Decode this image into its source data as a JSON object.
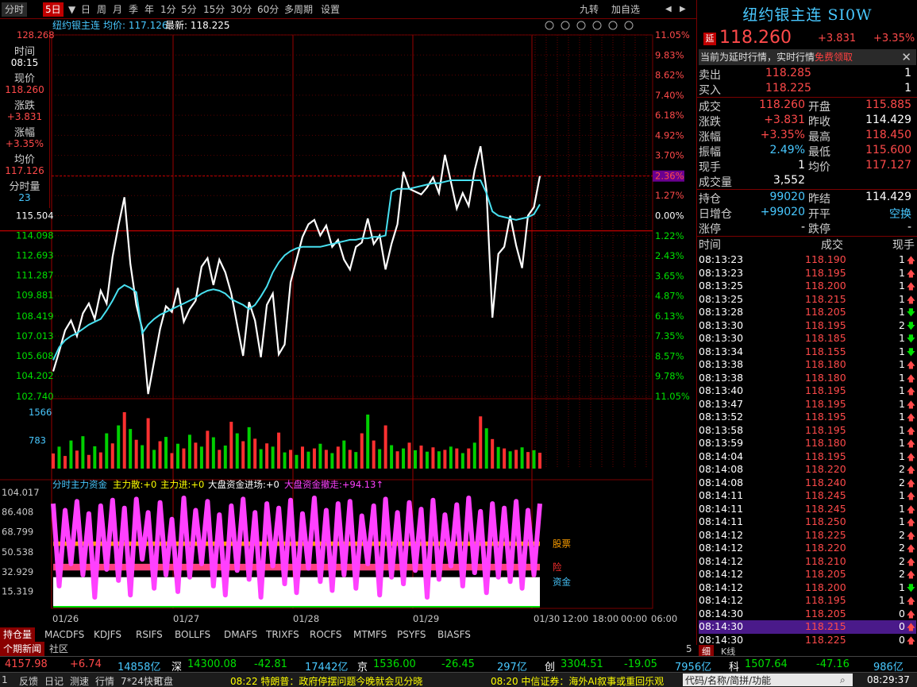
{
  "toolbar": {
    "items": [
      "分时",
      "5日",
      "▼",
      "日",
      "周",
      "月",
      "季",
      "年",
      "1分",
      "5分",
      "15分",
      "30分",
      "60分",
      "多周期",
      "设置"
    ],
    "selected": "5日",
    "right": [
      "九转",
      "加自选"
    ]
  },
  "chart_header": {
    "name": "纽约银主连",
    "avg_label": "均价:",
    "avg_value": "117.126",
    "latest_label": "最新:",
    "latest_value": "118.225"
  },
  "info_panel": {
    "time_label": "时间",
    "time_value": "08:15",
    "price_label": "现价",
    "price_value": "118.260",
    "change_label": "涨跌",
    "change_value": "+3.831",
    "pct_label": "涨幅",
    "pct_value": "+3.35%",
    "avg_label": "均价",
    "avg_value": "117.126",
    "vol_label": "分时量",
    "vol_value": "23"
  },
  "chart_data": [
    {
      "type": "line",
      "y_ticks_left": [
        "128.268",
        "115.504",
        "114.098",
        "112.693",
        "111.287",
        "109.881",
        "108.419",
        "107.013",
        "105.608",
        "104.202",
        "102.740"
      ],
      "y_ticks_right": [
        "11.05%",
        "9.83%",
        "8.62%",
        "7.40%",
        "6.18%",
        "4.92%",
        "3.70%",
        "2.36%",
        "1.27%",
        "0.00%",
        "1.22%",
        "2.43%",
        "3.65%",
        "4.87%",
        "6.13%",
        "7.35%",
        "8.57%",
        "9.78%",
        "11.05%"
      ],
      "x_ticks": [
        "01/26",
        "01/27",
        "01/28",
        "01/29",
        "01/30",
        "12:00",
        "18:00",
        "00:00",
        "06:00"
      ],
      "ylim": [
        102.74,
        128.268
      ],
      "reference_price": 114.429,
      "series": [
        {
          "values": [
            104.5,
            105.9,
            107.4,
            108.1,
            107.0,
            108.6,
            109.3,
            108.2,
            110.2,
            109.3,
            112.6,
            114.8,
            116.8,
            112.1,
            109.2,
            107.5,
            102.9,
            105.2,
            107.5,
            109.1,
            108.7,
            110.4,
            108.0,
            108.9,
            109.5,
            111.9,
            112.5,
            110.6,
            112.4,
            111.5,
            110.0,
            107.8,
            105.6,
            109.4,
            108.1,
            105.5,
            109.2,
            110.0,
            105.7,
            106.4,
            110.8,
            112.4,
            114.0,
            114.9,
            115.2,
            114.1,
            114.8,
            113.3,
            113.8,
            112.4,
            111.7,
            113.3,
            113.6,
            115.3,
            113.5,
            114.1,
            111.7,
            113.5,
            114.9,
            118.6,
            117.4,
            117.2,
            117.0,
            117.5,
            118.2,
            117.1,
            119.8,
            117.9,
            116.0,
            117.1,
            116.2,
            118.7,
            120.4,
            117.3,
            108.3,
            112.8,
            113.3,
            115.5,
            113.4,
            111.8,
            115.5,
            116.1,
            118.3
          ],
          "color": "#ffffff"
        },
        {
          "values": [
            105.3,
            106.2,
            106.7,
            107.0,
            107.2,
            107.5,
            107.8,
            108.0,
            108.2,
            108.8,
            109.5,
            110.3,
            110.6,
            110.4,
            110.1,
            107.2,
            107.8,
            108.2,
            108.5,
            108.7,
            108.9,
            109.1,
            109.3,
            109.5,
            109.7,
            110.0,
            110.2,
            110.3,
            110.2,
            110.0,
            109.6,
            109.4,
            109.2,
            108.9,
            109.2,
            109.8,
            110.5,
            111.5,
            112.2,
            112.7,
            113.0,
            113.2,
            113.3,
            113.3,
            113.3,
            113.3,
            113.4,
            113.5,
            113.6,
            113.7,
            113.8,
            113.8,
            113.9,
            113.9,
            114.0,
            114.0,
            114.1,
            117.2,
            117.4,
            117.4,
            117.4,
            117.5,
            117.6,
            117.7,
            117.8,
            117.8,
            117.9,
            118.0,
            118.0,
            118.0,
            118.0,
            118.0,
            118.0,
            117.1,
            115.8,
            115.5,
            115.4,
            115.3,
            115.2,
            115.3,
            115.4,
            115.6,
            116.3
          ],
          "color": "#48e0f0"
        }
      ]
    },
    {
      "type": "bar",
      "y_ticks_left": [
        "1566",
        "783"
      ],
      "series": [
        {
          "values": [
            420,
            610,
            350,
            780,
            500,
            900,
            380,
            620,
            450,
            980,
            700,
            1200,
            1566,
            1100,
            800,
            650,
            1400,
            520,
            760,
            880,
            430,
            690,
            560,
            940,
            720,
            610,
            1050,
            870,
            520,
            640,
            1300,
            980,
            760,
            1150,
            830,
            540,
            700,
            610,
            1000,
            450,
            520,
            380,
            610,
            470,
            560,
            690,
            520,
            430,
            610,
            780,
            520,
            460,
            980,
            1500,
            780,
            540,
            1200,
            650,
            480,
            560,
            720,
            510,
            640,
            470,
            590,
            480,
            520,
            610,
            560,
            430,
            560,
            720,
            1450,
            1120,
            820,
            600,
            560,
            480,
            520,
            590,
            460,
            510,
            440
          ],
          "colors": [
            "#ff3030",
            "#00d000"
          ]
        }
      ]
    },
    {
      "type": "bar",
      "title": "分时主力资金",
      "legend": [
        {
          "label": "主力散:",
          "value": "+0",
          "color": "#ffff00"
        },
        {
          "label": "主力进:",
          "value": "+0",
          "color": "#ffff00"
        },
        {
          "label": "大盘资金进场:",
          "value": "+0",
          "color": "#ffffff"
        },
        {
          "label": "大盘资金撤走:",
          "value": "+94.13↑",
          "color": "#ff40ff"
        }
      ],
      "y_ticks_left": [
        "104.017",
        "86.408",
        "68.799",
        "50.538",
        "32.929",
        "15.319"
      ],
      "ylim": [
        0,
        104.017
      ],
      "overlay_labels": [
        {
          "text": "股票",
          "color": "#ffa000"
        },
        {
          "text": "险",
          "color": "#ff3030"
        },
        {
          "text": "资金",
          "color": "#48c8ff"
        }
      ],
      "series": [
        {
          "name": "大盘资金撤走",
          "values": [
            94,
            20,
            88,
            40,
            96,
            30,
            85,
            10,
            92,
            35,
            97,
            25,
            90,
            12,
            98,
            44,
            86,
            18,
            95,
            30,
            80,
            15,
            99,
            28,
            88,
            40,
            96,
            20,
            84,
            12,
            92,
            34,
            98,
            26,
            86,
            10,
            94,
            38,
            90,
            22,
            97,
            14,
            85,
            36,
            99,
            24,
            88,
            16,
            94,
            30,
            96,
            18,
            83,
            40,
            92,
            12,
            98,
            28,
            86,
            22,
            95,
            34,
            89,
            10,
            97,
            26,
            84,
            38,
            93,
            20,
            99,
            32,
            87,
            14,
            94,
            28,
            90,
            24,
            96,
            18,
            88,
            30,
            94
          ],
          "color": "#ff40ff"
        }
      ]
    }
  ],
  "quote": {
    "title": "纽约银主连 SI0W",
    "delayed_tag": "延",
    "price": "118.260",
    "change": "+3.831",
    "pct": "+3.35%",
    "notice": "当前为延时行情，实时行情",
    "notice_link": "免费领取",
    "sell_label": "卖出",
    "sell_price": "118.285",
    "sell_qty": "1",
    "buy_label": "买入",
    "buy_price": "118.225",
    "buy_qty": "1",
    "rows": [
      {
        "l1": "成交",
        "v1": "118.260",
        "c1": "red",
        "l2": "开盘",
        "v2": "115.885",
        "c2": "red"
      },
      {
        "l1": "涨跌",
        "v1": "+3.831",
        "c1": "red",
        "l2": "昨收",
        "v2": "114.429",
        "c2": "white"
      },
      {
        "l1": "涨幅",
        "v1": "+3.35%",
        "c1": "red",
        "l2": "最高",
        "v2": "118.450",
        "c2": "red"
      },
      {
        "l1": "振幅",
        "v1": "2.49%",
        "c1": "cyan",
        "l2": "最低",
        "v2": "115.600",
        "c2": "red"
      },
      {
        "l1": "现手",
        "v1": "1",
        "c1": "white",
        "l2": "均价",
        "v2": "117.127",
        "c2": "red"
      }
    ],
    "volume_label": "成交量",
    "volume_value": "3,552",
    "oi_rows": [
      {
        "l1": "持仓",
        "v1": "99020",
        "c1": "cyan",
        "l2": "昨结",
        "v2": "114.429",
        "c2": "white"
      },
      {
        "l1": "日增仓",
        "v1": "+99020",
        "c1": "cyan",
        "l2": "开平",
        "v2": "空换",
        "c2": "cyan"
      },
      {
        "l1": "涨停",
        "v1": "-",
        "c1": "white",
        "l2": "跌停",
        "v2": "-",
        "c2": "white"
      }
    ],
    "ticks_header": [
      "时间",
      "成交",
      "现手"
    ],
    "ticks": [
      {
        "t": "08:13:23",
        "p": "118.190",
        "q": "1",
        "d": "up"
      },
      {
        "t": "08:13:23",
        "p": "118.195",
        "q": "1",
        "d": "up"
      },
      {
        "t": "08:13:25",
        "p": "118.200",
        "q": "1",
        "d": "up"
      },
      {
        "t": "08:13:25",
        "p": "118.215",
        "q": "1",
        "d": "up"
      },
      {
        "t": "08:13:28",
        "p": "118.205",
        "q": "1",
        "d": "down"
      },
      {
        "t": "08:13:30",
        "p": "118.195",
        "q": "2",
        "d": "down"
      },
      {
        "t": "08:13:30",
        "p": "118.185",
        "q": "1",
        "d": "down"
      },
      {
        "t": "08:13:34",
        "p": "118.155",
        "q": "1",
        "d": "down"
      },
      {
        "t": "08:13:38",
        "p": "118.180",
        "q": "1",
        "d": "up"
      },
      {
        "t": "08:13:38",
        "p": "118.180",
        "q": "1",
        "d": "up"
      },
      {
        "t": "08:13:40",
        "p": "118.195",
        "q": "1",
        "d": "up"
      },
      {
        "t": "08:13:47",
        "p": "118.195",
        "q": "1",
        "d": "up"
      },
      {
        "t": "08:13:52",
        "p": "118.195",
        "q": "1",
        "d": "up"
      },
      {
        "t": "08:13:58",
        "p": "118.195",
        "q": "1",
        "d": "up"
      },
      {
        "t": "08:13:59",
        "p": "118.180",
        "q": "1",
        "d": "up"
      },
      {
        "t": "08:14:04",
        "p": "118.195",
        "q": "1",
        "d": "up"
      },
      {
        "t": "08:14:08",
        "p": "118.220",
        "q": "2",
        "d": "up"
      },
      {
        "t": "08:14:08",
        "p": "118.240",
        "q": "2",
        "d": "up"
      },
      {
        "t": "08:14:11",
        "p": "118.245",
        "q": "1",
        "d": "up"
      },
      {
        "t": "08:14:11",
        "p": "118.245",
        "q": "1",
        "d": "up"
      },
      {
        "t": "08:14:11",
        "p": "118.250",
        "q": "1",
        "d": "up"
      },
      {
        "t": "08:14:12",
        "p": "118.225",
        "q": "2",
        "d": "up"
      },
      {
        "t": "08:14:12",
        "p": "118.220",
        "q": "2",
        "d": "up"
      },
      {
        "t": "08:14:12",
        "p": "118.210",
        "q": "2",
        "d": "up"
      },
      {
        "t": "08:14:12",
        "p": "118.205",
        "q": "2",
        "d": "up"
      },
      {
        "t": "08:14:12",
        "p": "118.200",
        "q": "1",
        "d": "down"
      },
      {
        "t": "08:14:12",
        "p": "118.195",
        "q": "1",
        "d": "up"
      },
      {
        "t": "08:14:30",
        "p": "118.205",
        "q": "0",
        "d": "up"
      },
      {
        "t": "08:14:30",
        "p": "118.215",
        "q": "0",
        "d": "up",
        "highlight": true
      },
      {
        "t": "08:14:30",
        "p": "118.225",
        "q": "0",
        "d": "up"
      }
    ],
    "sub_tabs": [
      "细",
      "K线"
    ]
  },
  "bottom_tabs": [
    "持仓量",
    "MACDFS",
    "KDJFS",
    "RSIFS",
    "BOLLFS",
    "DMAFS",
    "TRIXFS",
    "ROCFS",
    "MTMFS",
    "PSYFS",
    "BIASFS"
  ],
  "status_bar": [
    {
      "text": "4157.98",
      "color": "red"
    },
    {
      "text": "+6.74",
      "color": "red"
    },
    {
      "text": "14858亿",
      "color": "cyan"
    },
    {
      "text": "深",
      "color": "white"
    },
    {
      "text": "14300.08",
      "color": "green"
    },
    {
      "text": "-42.81",
      "color": "green"
    },
    {
      "text": "17442亿",
      "color": "cyan"
    },
    {
      "text": "京",
      "color": "white"
    },
    {
      "text": "1536.00",
      "color": "green"
    },
    {
      "text": "-26.45",
      "color": "green"
    },
    {
      "text": "297亿",
      "color": "cyan"
    },
    {
      "text": "创",
      "color": "white"
    },
    {
      "text": "3304.51",
      "color": "green"
    },
    {
      "text": "-19.05",
      "color": "green"
    },
    {
      "text": "7956亿",
      "color": "cyan"
    },
    {
      "text": "科",
      "color": "white"
    },
    {
      "text": "1507.64",
      "color": "green"
    },
    {
      "text": "-47.16",
      "color": "green"
    },
    {
      "text": "986亿",
      "color": "cyan"
    }
  ],
  "taskbar": {
    "items": [
      "个期新闻",
      "社区"
    ],
    "bottom": [
      "1",
      "反馈",
      "日记",
      "测速",
      "行情",
      "7*24快讯",
      "盯盘"
    ],
    "news1": "08:22 特朗普：政府停摆问题今晚就会见分晓",
    "news2": "08:20 中信证券：海外AI叙事或重回乐观",
    "search_placeholder": "代码/名称/简拼/功能",
    "clock": "08:29:37",
    "sub_tab": "5"
  }
}
